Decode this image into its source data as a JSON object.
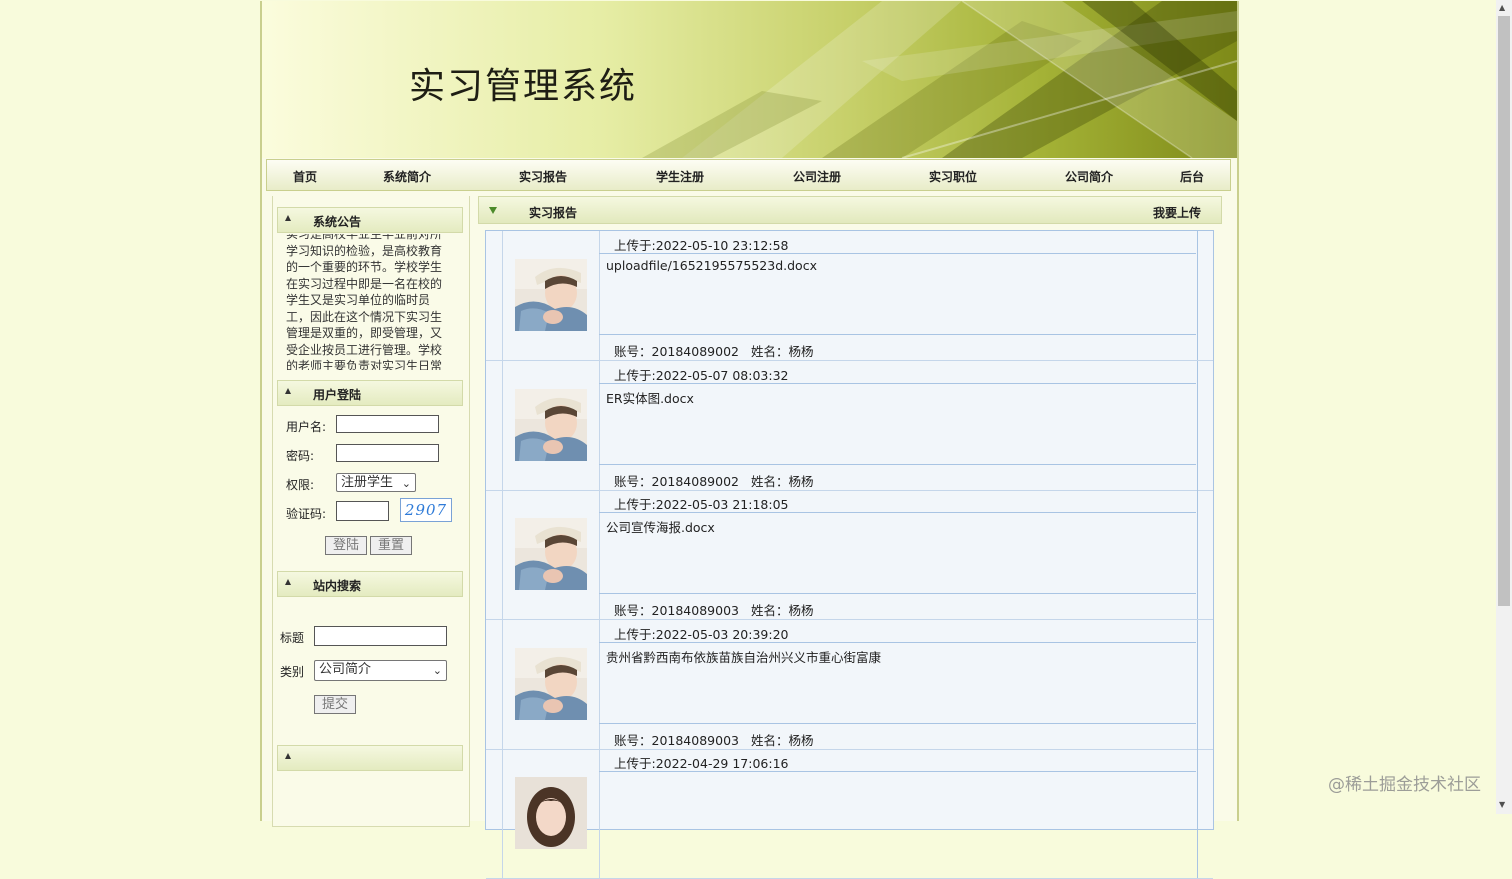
{
  "banner": {
    "title": "实习管理系统"
  },
  "nav": [
    "首页",
    "系统简介",
    "实习报告",
    "学生注册",
    "公司注册",
    "实习职位",
    "公司简介",
    "后台"
  ],
  "sidebar": {
    "notice": {
      "title": "系统公告",
      "text": "实习是高校毕业生毕业前对所学习知识的检验，是高校教育的一个重要的环节。学校学生在实习过程中即是一名在校的学生又是实习单位的临时员工，因此在这个情况下实习生管理是双重的，即受管理，又受企业按员工进行管理。学校的老师主要负责对实习生日常"
    },
    "login": {
      "title": "用户登陆",
      "username_label": "用户名:",
      "password_label": "密码:",
      "role_label": "权限:",
      "role_value": "注册学生",
      "captcha_label": "验证码:",
      "captcha": "2907",
      "login_button": "登陆",
      "reset_button": "重置"
    },
    "search": {
      "title": "站内搜索",
      "title_label": "标题",
      "category_label": "类别",
      "category_value": "公司简介",
      "submit_button": "提交"
    },
    "extra": {
      "title": ""
    }
  },
  "main": {
    "title": "实习报告",
    "upload_link": "我要上传",
    "reports": [
      {
        "time": "上传于:2022-05-10 23:12:58",
        "file": "uploadfile/1652195575523d.docx",
        "account": "账号：20184089002",
        "name": "姓名：杨杨",
        "avatar": "boy"
      },
      {
        "time": "上传于:2022-05-07 08:03:32",
        "file": "ER实体图.docx",
        "account": "账号：20184089002",
        "name": "姓名：杨杨",
        "avatar": "boy"
      },
      {
        "time": "上传于:2022-05-03 21:18:05",
        "file": "公司宣传海报.docx",
        "account": "账号：20184089003",
        "name": "姓名：杨杨",
        "avatar": "boy"
      },
      {
        "time": "上传于:2022-05-03 20:39:20",
        "file": "贵州省黔西南布依族苗族自治州兴义市重心街富康",
        "account": "账号：20184089003",
        "name": "姓名：杨杨",
        "avatar": "boy"
      },
      {
        "time": "上传于:2022-04-29 17:06:16",
        "file": "",
        "account": "",
        "name": "",
        "avatar": "girl"
      }
    ]
  },
  "watermark": "@稀土掘金技术社区"
}
